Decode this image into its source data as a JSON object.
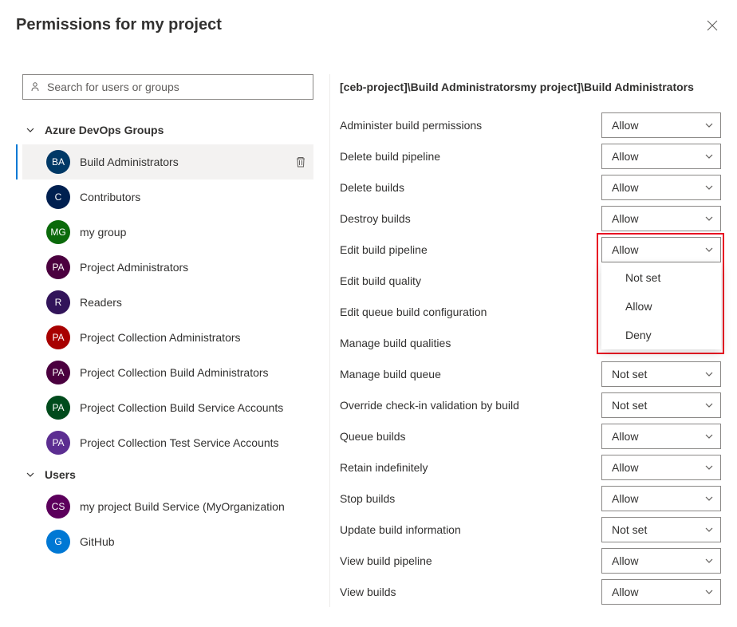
{
  "title": "Permissions for my project",
  "search": {
    "placeholder": "Search for users or groups"
  },
  "sections": {
    "groups_label": "Azure DevOps Groups",
    "users_label": "Users"
  },
  "groups": [
    {
      "initials": "BA",
      "label": "Build Administrators",
      "color": "#003966",
      "selected": true
    },
    {
      "initials": "C",
      "label": "Contributors",
      "color": "#002050"
    },
    {
      "initials": "MG",
      "label": "my group",
      "color": "#0b6a0b"
    },
    {
      "initials": "PA",
      "label": "Project Administrators",
      "color": "#4b003f"
    },
    {
      "initials": "R",
      "label": "Readers",
      "color": "#32145a"
    },
    {
      "initials": "PA",
      "label": "Project Collection Administrators",
      "color": "#a80000"
    },
    {
      "initials": "PA",
      "label": "Project Collection Build Administrators",
      "color": "#4b003f"
    },
    {
      "initials": "PA",
      "label": "Project Collection Build Service Accounts",
      "color": "#004b1c"
    },
    {
      "initials": "PA",
      "label": "Project Collection Test Service Accounts",
      "color": "#5c2e91"
    }
  ],
  "users": [
    {
      "initials": "CS",
      "label": "my project Build Service (MyOrganization",
      "color": "#5c005c"
    },
    {
      "initials": "G",
      "label": "GitHub",
      "color": "#0078d4"
    }
  ],
  "breadcrumb": "[ceb-project]\\Build Administratorsmy project]\\Build Administrators",
  "permissions": [
    {
      "label": "Administer build permissions",
      "value": "Allow"
    },
    {
      "label": "Delete build pipeline",
      "value": "Allow"
    },
    {
      "label": "Delete builds",
      "value": "Allow"
    },
    {
      "label": "Destroy builds",
      "value": "Allow"
    },
    {
      "label": "Edit build pipeline",
      "value": "Allow",
      "open": true
    },
    {
      "label": "Edit build quality",
      "value": ""
    },
    {
      "label": "Edit queue build configuration",
      "value": ""
    },
    {
      "label": "Manage build qualities",
      "value": ""
    },
    {
      "label": "Manage build queue",
      "value": "Not set"
    },
    {
      "label": "Override check-in validation by build",
      "value": "Not set"
    },
    {
      "label": "Queue builds",
      "value": "Allow"
    },
    {
      "label": "Retain indefinitely",
      "value": "Allow"
    },
    {
      "label": "Stop builds",
      "value": "Allow"
    },
    {
      "label": "Update build information",
      "value": "Not set"
    },
    {
      "label": "View build pipeline",
      "value": "Allow"
    },
    {
      "label": "View builds",
      "value": "Allow"
    }
  ],
  "dropdown_options": [
    "Not set",
    "Allow",
    "Deny"
  ]
}
